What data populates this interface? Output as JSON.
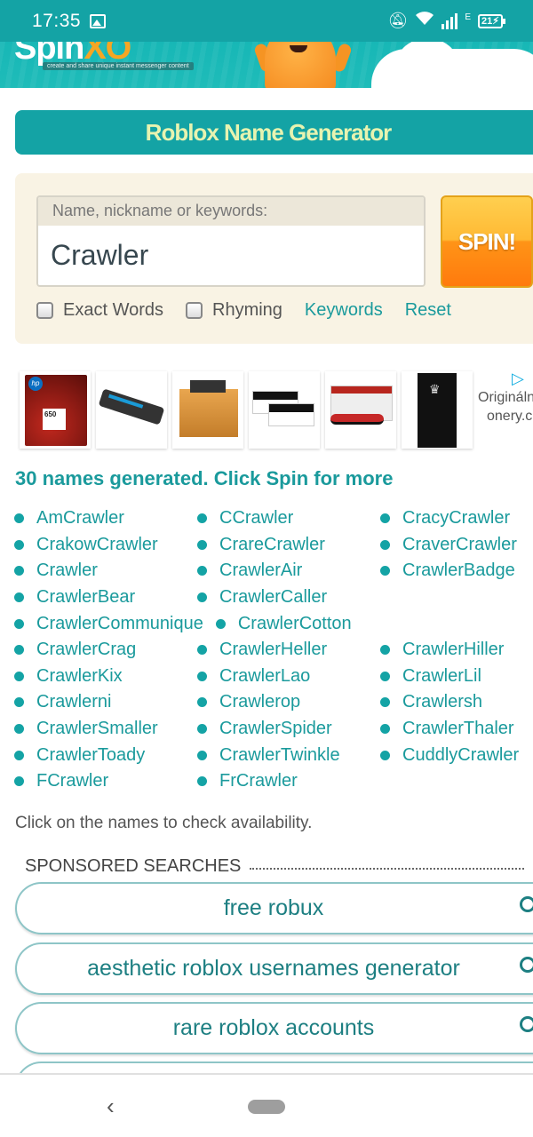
{
  "status_bar": {
    "time": "17:35",
    "network_label": "E",
    "battery": "21"
  },
  "banner": {
    "logo_main": "Spin",
    "logo_accent": "XO",
    "tagline": "create and share unique instant messenger content"
  },
  "header": {
    "title": "Roblox Name Generator"
  },
  "form": {
    "field_label": "Name, nickname or keywords:",
    "field_value": "Crawler",
    "spin_label": "SPIN!",
    "exact_words_label": "Exact Words",
    "exact_words_checked": false,
    "rhyming_label": "Rhyming",
    "rhyming_checked": false,
    "keywords_link": "Keywords",
    "reset_link": "Reset"
  },
  "ads": {
    "side_text_line1": "Origináln",
    "side_text_line2": "onery.c",
    "products": [
      "hp-650-ink-cartridge",
      "imaging-unit",
      "brother-belt-unit",
      "transparency-sheets",
      "oki-drum-unit",
      "toner-box"
    ]
  },
  "results": {
    "summary": "30 names generated. Click Spin for more",
    "names": [
      "AmCrawler",
      "CCrawler",
      "CracyCrawler",
      "CrakowCrawler",
      "CrareCrawler",
      "CraverCrawler",
      "Crawler",
      "CrawlerAir",
      "CrawlerBadge",
      "CrawlerBear",
      "CrawlerCaller",
      "CrawlerCommunique",
      "CrawlerCotton",
      "CrawlerCrag",
      "CrawlerHeller",
      "CrawlerHiller",
      "CrawlerKix",
      "CrawlerLao",
      "CrawlerLil",
      "Crawlerni",
      "Crawlerop",
      "Crawlersh",
      "CrawlerSmaller",
      "CrawlerSpider",
      "CrawlerThaler",
      "CrawlerToady",
      "CrawlerTwinkle",
      "CuddlyCrawler",
      "FCrawler",
      "FrCrawler"
    ],
    "note": "Click on the names to check availability."
  },
  "sponsored": {
    "heading": "SPONSORED SEARCHES",
    "searches": [
      "free robux",
      "aesthetic roblox usernames generator",
      "rare roblox accounts"
    ]
  },
  "colors": {
    "brand_teal": "#14a3a5",
    "title_text": "#e7f3b0",
    "spin_orange": "#ff9417",
    "link_teal": "#1a9a9c"
  }
}
